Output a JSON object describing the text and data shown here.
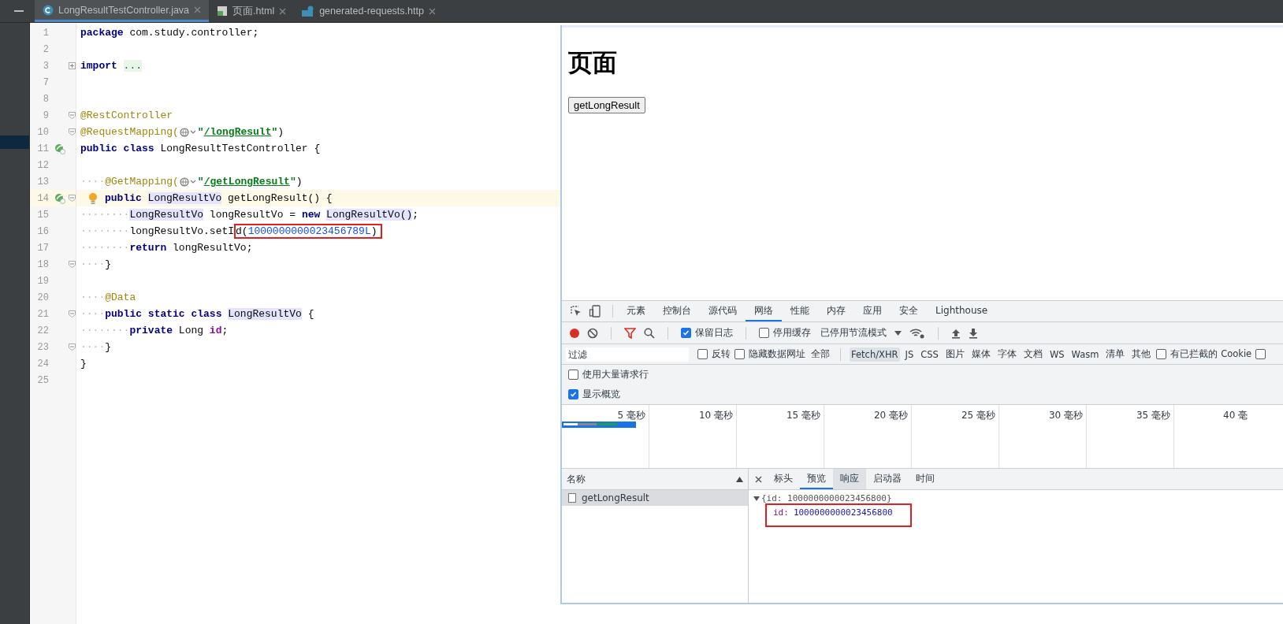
{
  "editor_tabs": [
    {
      "label": "LongResultTestController.java",
      "kind": "java",
      "selected": true
    },
    {
      "label": "页面.html",
      "kind": "html",
      "selected": false
    },
    {
      "label": "generated-requests.http",
      "kind": "api",
      "selected": false
    }
  ],
  "code_lines": [
    {
      "number": "1",
      "tokens": [
        {
          "kind": "kw",
          "text": "package"
        },
        {
          "kind": "plain",
          "text": " com.study.controller;"
        }
      ]
    },
    {
      "number": "2"
    },
    {
      "number": "3",
      "fold": true,
      "folded": true,
      "tokens": [
        {
          "kind": "kw",
          "text": "import "
        },
        {
          "kind": "folded",
          "text": "..."
        }
      ]
    },
    {
      "number": "7"
    },
    {
      "number": "8"
    },
    {
      "number": "9",
      "fold": true,
      "folded": false,
      "tokens": [
        {
          "kind": "ann",
          "text": "@RestController"
        }
      ]
    },
    {
      "number": "10",
      "fold": true,
      "folded": false,
      "tokens": [
        {
          "kind": "ann",
          "text": "@RequestMapping("
        },
        {
          "kind": "globe"
        },
        {
          "kind": "str",
          "text": "\""
        },
        {
          "kind": "link",
          "text": "/longResult"
        },
        {
          "kind": "str",
          "text": "\""
        },
        {
          "kind": "plain",
          "text": ")"
        }
      ]
    },
    {
      "number": "11",
      "bean": true,
      "tokens": [
        {
          "kind": "kw",
          "text": "public class "
        },
        {
          "kind": "plain",
          "text": "LongResultTestController {"
        }
      ]
    },
    {
      "number": "12"
    },
    {
      "number": "13",
      "tokens": [
        {
          "kind": "ws",
          "text": "····"
        },
        {
          "kind": "ann",
          "text": "@GetMapping("
        },
        {
          "kind": "globe"
        },
        {
          "kind": "str",
          "text": "\""
        },
        {
          "kind": "link",
          "text": "/getLongResult"
        },
        {
          "kind": "str",
          "text": "\""
        },
        {
          "kind": "plain",
          "text": ")"
        }
      ]
    },
    {
      "number": "14",
      "current": true,
      "bean": true,
      "fold": true,
      "folded": false,
      "bulb": true,
      "tokens": [
        {
          "kind": "kw",
          "text": "public "
        },
        {
          "kind": "ref",
          "text": "LongResultVo"
        },
        {
          "kind": "plain",
          "text": " getLongResult() {"
        }
      ]
    },
    {
      "number": "15",
      "tokens": [
        {
          "kind": "ws",
          "text": "········"
        },
        {
          "kind": "ref",
          "text": "LongResultVo"
        },
        {
          "kind": "plain",
          "text": " longResultVo = "
        },
        {
          "kind": "kw",
          "text": "new "
        },
        {
          "kind": "ref",
          "text": "LongResultVo()"
        },
        {
          "kind": "plain",
          "text": ";"
        }
      ]
    },
    {
      "number": "16",
      "tokens": [
        {
          "kind": "ws",
          "text": "········"
        },
        {
          "kind": "plain",
          "text": "longResultVo.setI"
        },
        {
          "kind": "boxed",
          "tokens": [
            {
              "kind": "plain",
              "text": "d("
            },
            {
              "kind": "num",
              "text": "1000000000023456789L"
            },
            {
              "kind": "plain",
              "text": ")"
            }
          ]
        }
      ]
    },
    {
      "number": "17",
      "tokens": [
        {
          "kind": "ws",
          "text": "········"
        },
        {
          "kind": "kw",
          "text": "return "
        },
        {
          "kind": "plain",
          "text": "longResultVo;"
        }
      ]
    },
    {
      "number": "18",
      "fold": true,
      "folded": false,
      "tokens": [
        {
          "kind": "ws",
          "text": "····"
        },
        {
          "kind": "plain",
          "text": "}"
        }
      ]
    },
    {
      "number": "19"
    },
    {
      "number": "20",
      "tokens": [
        {
          "kind": "ws",
          "text": "····"
        },
        {
          "kind": "ann",
          "text": "@Data"
        }
      ]
    },
    {
      "number": "21",
      "fold": true,
      "folded": false,
      "tokens": [
        {
          "kind": "ws",
          "text": "····"
        },
        {
          "kind": "kw",
          "text": "public static class "
        },
        {
          "kind": "ref",
          "text": "LongResultVo"
        },
        {
          "kind": "plain",
          "text": " {"
        }
      ]
    },
    {
      "number": "22",
      "tokens": [
        {
          "kind": "ws",
          "text": "········"
        },
        {
          "kind": "kw",
          "text": "private "
        },
        {
          "kind": "plain",
          "text": "Long "
        },
        {
          "kind": "field",
          "text": "id"
        },
        {
          "kind": "plain",
          "text": ";"
        }
      ]
    },
    {
      "number": "23",
      "fold": true,
      "folded": false,
      "tokens": [
        {
          "kind": "ws",
          "text": "····"
        },
        {
          "kind": "plain",
          "text": "}"
        }
      ]
    },
    {
      "number": "24",
      "tokens": [
        {
          "kind": "plain",
          "text": "}"
        }
      ]
    },
    {
      "number": "25"
    }
  ],
  "browser": {
    "heading": "页面",
    "button": "getLongResult"
  },
  "devtools": {
    "tabs": [
      {
        "label": "元素",
        "selected": false
      },
      {
        "label": "控制台",
        "selected": false
      },
      {
        "label": "源代码",
        "selected": false
      },
      {
        "label": "网络",
        "selected": true
      },
      {
        "label": "性能",
        "selected": false
      },
      {
        "label": "内存",
        "selected": false
      },
      {
        "label": "应用",
        "selected": false
      },
      {
        "label": "安全",
        "selected": false
      },
      {
        "label": "Lighthouse",
        "selected": false
      }
    ],
    "toolbar": {
      "recording": true,
      "checkboxes": [
        {
          "label": "保留日志",
          "checked": true
        },
        {
          "label": "停用缓存",
          "checked": false
        }
      ],
      "throttling": "已停用节流模式"
    },
    "filter": {
      "placeholder": "过滤",
      "checkboxes": [
        {
          "label": "反转",
          "checked": false
        },
        {
          "label": "隐藏数据网址",
          "checked": false
        }
      ],
      "types": [
        {
          "label": "全部",
          "selected": false
        },
        {
          "label": "Fetch/XHR",
          "selected": true
        },
        {
          "label": "JS",
          "selected": false
        },
        {
          "label": "CSS",
          "selected": false
        },
        {
          "label": "图片",
          "selected": false
        },
        {
          "label": "媒体",
          "selected": false
        },
        {
          "label": "字体",
          "selected": false
        },
        {
          "label": "文档",
          "selected": false
        },
        {
          "label": "WS",
          "selected": false
        },
        {
          "label": "Wasm",
          "selected": false
        },
        {
          "label": "清单",
          "selected": false
        },
        {
          "label": "其他",
          "selected": false
        }
      ],
      "end_checkboxes": [
        {
          "label": "有已拦截的 Cookie",
          "checked": false
        },
        {
          "checked": false
        }
      ]
    },
    "options": [
      {
        "label": "使用大量请求行",
        "checked": false
      },
      {
        "label": "显示概览",
        "checked": true
      }
    ],
    "overview": {
      "ticks": [
        "5 毫秒",
        "10 毫秒",
        "15 毫秒",
        "20 毫秒",
        "25 毫秒",
        "30 毫秒",
        "35 毫秒",
        "40 毫"
      ]
    },
    "requests": {
      "header": "名称",
      "rows": [
        {
          "name": "getLongResult",
          "selected": true
        }
      ]
    },
    "detail": {
      "tabs": [
        {
          "label": "标头",
          "selected": false
        },
        {
          "label": "预览",
          "selected": true
        },
        {
          "label": "响应",
          "selected": false
        },
        {
          "label": "启动器",
          "selected": false
        },
        {
          "label": "时间",
          "selected": false
        }
      ],
      "preview": {
        "summary": "{id: 1000000000023456800}",
        "expanded": true,
        "properties": [
          {
            "key": "id:",
            "value": "1000000000023456800",
            "highlighted": true
          }
        ]
      }
    }
  }
}
